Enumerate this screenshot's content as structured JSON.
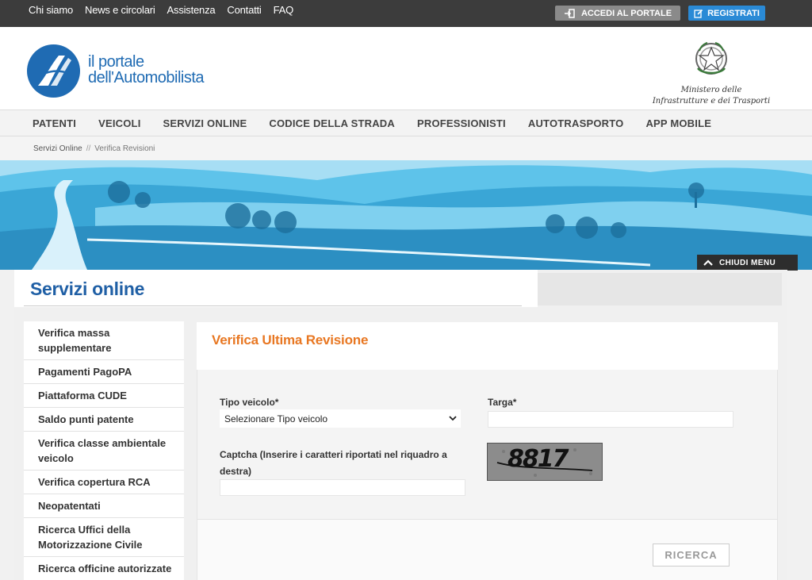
{
  "topbar": {
    "links": [
      "Chi siamo",
      "News e circolari",
      "Assistenza",
      "Contatti",
      "FAQ"
    ],
    "portal_button": "ACCEDI AL PORTALE",
    "register_button": "REGISTRATI"
  },
  "header": {
    "logo_line1": "il portale",
    "logo_line2": "dell'Automobilista",
    "ministry_line1": "Ministero delle",
    "ministry_line2": "Infrastrutture e dei Trasporti"
  },
  "nav": [
    "PATENTI",
    "VEICOLI",
    "SERVIZI ONLINE",
    "CODICE DELLA STRADA",
    "PROFESSIONISTI",
    "AUTOTRASPORTO",
    "APP MOBILE"
  ],
  "breadcrumb": {
    "root": "Servizi Online",
    "separator": "//",
    "current": "Verifica Revisioni"
  },
  "banner": {
    "close_menu": "CHIUDI MENU"
  },
  "page": {
    "title": "Servizi online"
  },
  "sidebar": [
    "Verifica massa supplementare",
    "Pagamenti PagoPA",
    "Piattaforma CUDE",
    "Saldo punti patente",
    "Verifica classe ambientale veicolo",
    "Verifica copertura RCA",
    "Neopatentati",
    "Ricerca Uffici della Motorizzazione Civile",
    "Ricerca officine autorizzate"
  ],
  "form": {
    "title": "Verifica Ultima Revisione",
    "vehicle_type_label": "Tipo veicolo*",
    "vehicle_type_value": "Selezionare Tipo veicolo",
    "plate_label": "Targa*",
    "plate_value": "",
    "captcha_label": "Captcha (Inserire i caratteri riportati nel riquadro a destra)",
    "captcha_value": "",
    "captcha_image_text": "8817",
    "submit": "RICERCA"
  },
  "colors": {
    "topbar": "#3c3c3c",
    "brand_blue": "#1f6bb3",
    "accent_orange": "#e87722",
    "register_blue": "#2a8ad6"
  }
}
